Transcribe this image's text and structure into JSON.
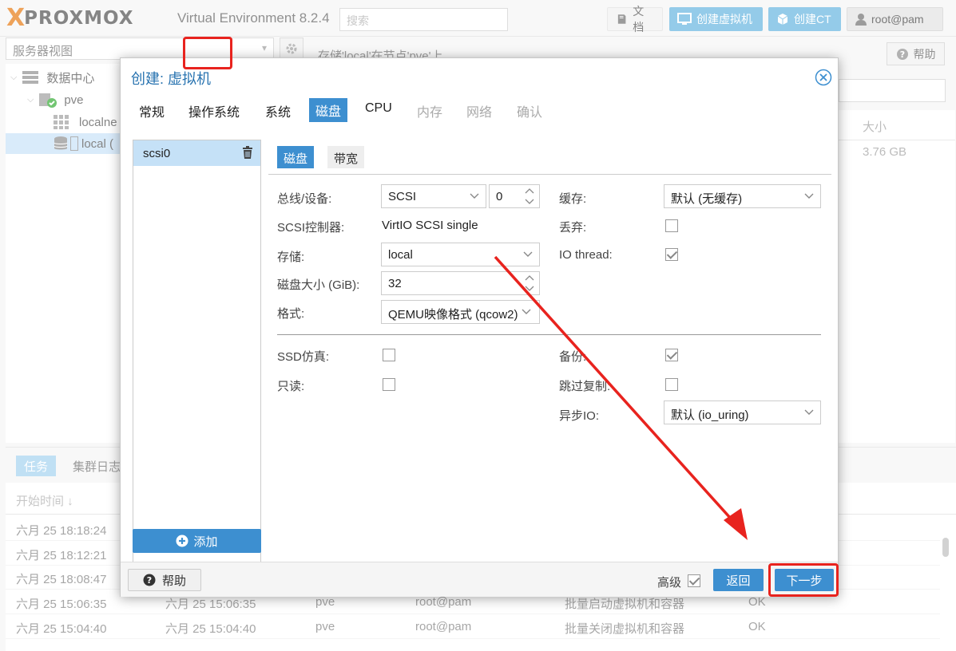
{
  "app": {
    "logo_x": "X",
    "logo_text": "PROXMOX",
    "version": "Virtual Environment 8.2.4"
  },
  "topbar": {
    "search_placeholder": "搜索",
    "docs_label": "文档",
    "create_vm_label": "创建虚拟机",
    "create_ct_label": "创建CT",
    "user_label": "root@pam"
  },
  "left": {
    "view_selector": "服务器视图",
    "tree": [
      {
        "label": "数据中心"
      },
      {
        "label": "pve"
      },
      {
        "label": "localne"
      },
      {
        "label": "local ("
      }
    ]
  },
  "right": {
    "header": "存储'local'在节点'pve'上",
    "help_label": "帮助",
    "grid_header": "大小",
    "grid_value": "3.76 GB"
  },
  "tasks": {
    "tabs": [
      "任务",
      "集群日志"
    ],
    "col_start": "开始时间 ↓",
    "rows": [
      {
        "start": "六月 25 18:18:24",
        "end": "",
        "node": "",
        "user": "",
        "desc": "",
        "status": ""
      },
      {
        "start": "六月 25 18:12:21",
        "end": "",
        "node": "",
        "user": "",
        "desc": "",
        "status": ""
      },
      {
        "start": "六月 25 18:08:47",
        "end": "",
        "node": "",
        "user": "",
        "desc": "",
        "status": ""
      },
      {
        "start": "六月 25 15:06:35",
        "end": "六月 25 15:06:35",
        "node": "pve",
        "user": "root@pam",
        "desc": "批量启动虚拟机和容器",
        "status": "OK"
      },
      {
        "start": "六月 25 15:04:40",
        "end": "六月 25 15:04:40",
        "node": "pve",
        "user": "root@pam",
        "desc": "批量关闭虚拟机和容器",
        "status": "OK"
      }
    ]
  },
  "dialog": {
    "title": "创建: 虚拟机",
    "tabs": [
      {
        "label": "常规",
        "state": "normal"
      },
      {
        "label": "操作系统",
        "state": "normal"
      },
      {
        "label": "系统",
        "state": "normal"
      },
      {
        "label": "磁盘",
        "state": "active"
      },
      {
        "label": "CPU",
        "state": "normal"
      },
      {
        "label": "内存",
        "state": "disabled"
      },
      {
        "label": "网络",
        "state": "disabled"
      },
      {
        "label": "确认",
        "state": "disabled"
      }
    ],
    "disk_list": [
      {
        "label": "scsi0"
      }
    ],
    "add_label": "添加",
    "subtabs": {
      "disk": "磁盘",
      "bandwidth": "带宽"
    },
    "fields": {
      "bus_label": "总线/设备:",
      "bus_value": "SCSI",
      "device_num": "0",
      "controller_label": "SCSI控制器:",
      "controller_value": "VirtIO SCSI single",
      "storage_label": "存储:",
      "storage_value": "local",
      "size_label": "磁盘大小 (GiB):",
      "size_value": "32",
      "format_label": "格式:",
      "format_value": "QEMU映像格式 (qcow2)",
      "cache_label": "缓存:",
      "cache_value": "默认 (无缓存)",
      "discard_label": "丢弃:",
      "discard_checked": false,
      "iothread_label": "IO thread:",
      "iothread_checked": true,
      "ssd_label": "SSD仿真:",
      "ssd_checked": false,
      "readonly_label": "只读:",
      "readonly_checked": false,
      "backup_label": "备份:",
      "backup_checked": true,
      "skip_repl_label": "跳过复制:",
      "skip_repl_checked": false,
      "async_io_label": "异步IO:",
      "async_io_value": "默认 (io_uring)"
    },
    "footer": {
      "help_label": "帮助",
      "advanced_label": "高级",
      "advanced_checked": true,
      "back_label": "返回",
      "next_label": "下一步"
    }
  },
  "colors": {
    "accent": "#3d8fd0",
    "title_blue": "#2873b0",
    "highlight_red": "#e8231e",
    "selection": "#c5e1f7",
    "brand_orange": "#e57000"
  }
}
